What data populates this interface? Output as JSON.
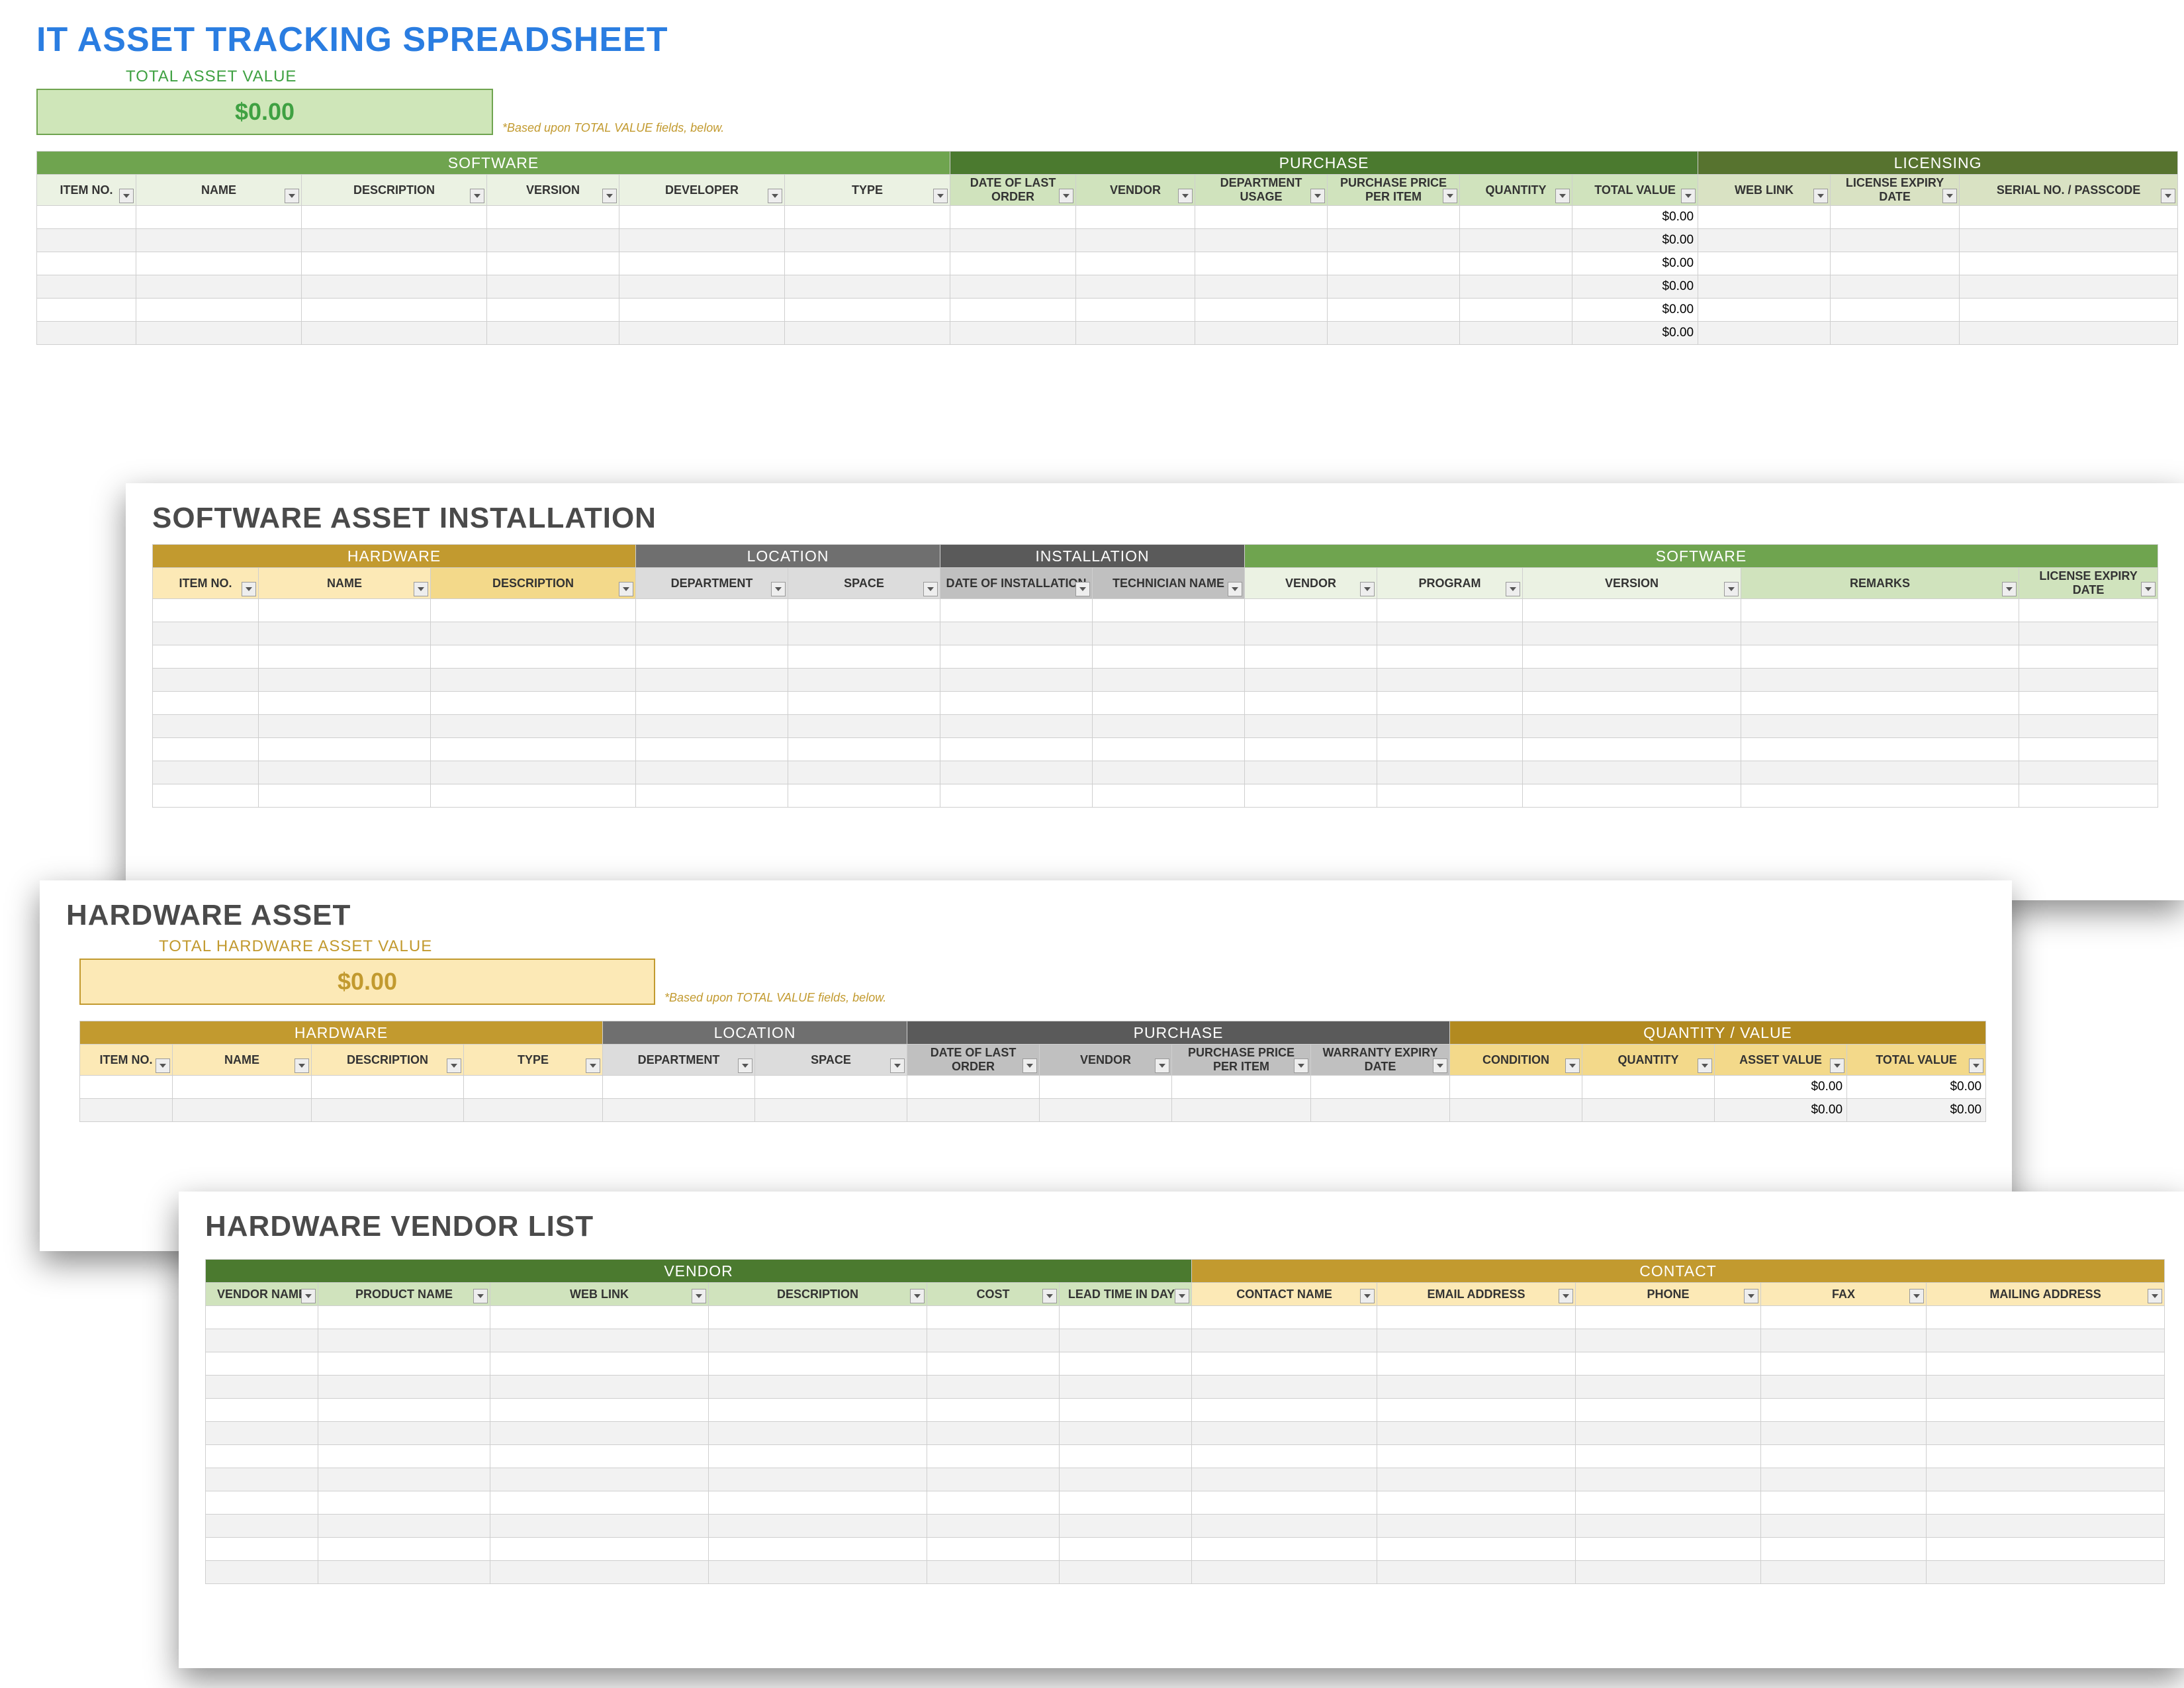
{
  "sheet1": {
    "title": "IT ASSET TRACKING SPREADSHEET",
    "total_label": "TOTAL ASSET VALUE",
    "total_value": "$0.00",
    "footnote": "*Based upon TOTAL VALUE fields, below.",
    "groups": {
      "software": "SOFTWARE",
      "purchase": "PURCHASE",
      "licensing": "LICENSING"
    },
    "cols": {
      "item_no": "ITEM NO.",
      "name": "NAME",
      "description": "DESCRIPTION",
      "version": "VERSION",
      "developer": "DEVELOPER",
      "type": "TYPE",
      "date_last_order": "DATE OF LAST ORDER",
      "vendor": "VENDOR",
      "department_usage": "DEPARTMENT USAGE",
      "price_per_item": "PURCHASE PRICE PER ITEM",
      "quantity": "QUANTITY",
      "total_value": "TOTAL VALUE",
      "web_link": "WEB LINK",
      "license_expiry": "LICENSE EXPIRY DATE",
      "serial": "SERIAL NO. / PASSCODE"
    },
    "row_totals": [
      "$0.00",
      "$0.00",
      "$0.00",
      "$0.00",
      "$0.00",
      "$0.00"
    ]
  },
  "sheet2": {
    "title": "SOFTWARE ASSET INSTALLATION",
    "groups": {
      "hardware": "HARDWARE",
      "location": "LOCATION",
      "installation": "INSTALLATION",
      "software": "SOFTWARE"
    },
    "cols": {
      "item_no": "ITEM NO.",
      "name": "NAME",
      "description": "DESCRIPTION",
      "department": "DEPARTMENT",
      "space": "SPACE",
      "date_install": "DATE OF INSTALLATION",
      "technician": "TECHNICIAN NAME",
      "vendor": "VENDOR",
      "program": "PROGRAM",
      "version": "VERSION",
      "remarks": "REMARKS",
      "license_expiry": "LICENSE EXPIRY DATE"
    }
  },
  "sheet3": {
    "title": "HARDWARE ASSET",
    "total_label": "TOTAL HARDWARE ASSET VALUE",
    "total_value": "$0.00",
    "footnote": "*Based upon TOTAL VALUE fields, below.",
    "groups": {
      "hardware": "HARDWARE",
      "location": "LOCATION",
      "purchase": "PURCHASE",
      "qty_value": "QUANTITY / VALUE"
    },
    "cols": {
      "item_no": "ITEM NO.",
      "name": "NAME",
      "description": "DESCRIPTION",
      "type": "TYPE",
      "department": "DEPARTMENT",
      "space": "SPACE",
      "date_last_order": "DATE OF LAST ORDER",
      "vendor": "VENDOR",
      "price_per_item": "PURCHASE PRICE PER ITEM",
      "warranty_expiry": "WARRANTY EXPIRY DATE",
      "condition": "CONDITION",
      "quantity": "QUANTITY",
      "asset_value": "ASSET VALUE",
      "total_value": "TOTAL VALUE"
    },
    "rows": [
      {
        "asset_value": "$0.00",
        "total_value": "$0.00"
      },
      {
        "asset_value": "$0.00",
        "total_value": "$0.00"
      }
    ]
  },
  "sheet4": {
    "title": "HARDWARE VENDOR LIST",
    "groups": {
      "vendor": "VENDOR",
      "contact": "CONTACT"
    },
    "cols": {
      "vendor_name": "VENDOR NAME",
      "product_name": "PRODUCT NAME",
      "web_link": "WEB LINK",
      "description": "DESCRIPTION",
      "cost": "COST",
      "lead_time": "LEAD TIME IN DAYS",
      "contact_name": "CONTACT NAME",
      "email": "EMAIL ADDRESS",
      "phone": "PHONE",
      "fax": "FAX",
      "mailing": "MAILING ADDRESS"
    }
  }
}
